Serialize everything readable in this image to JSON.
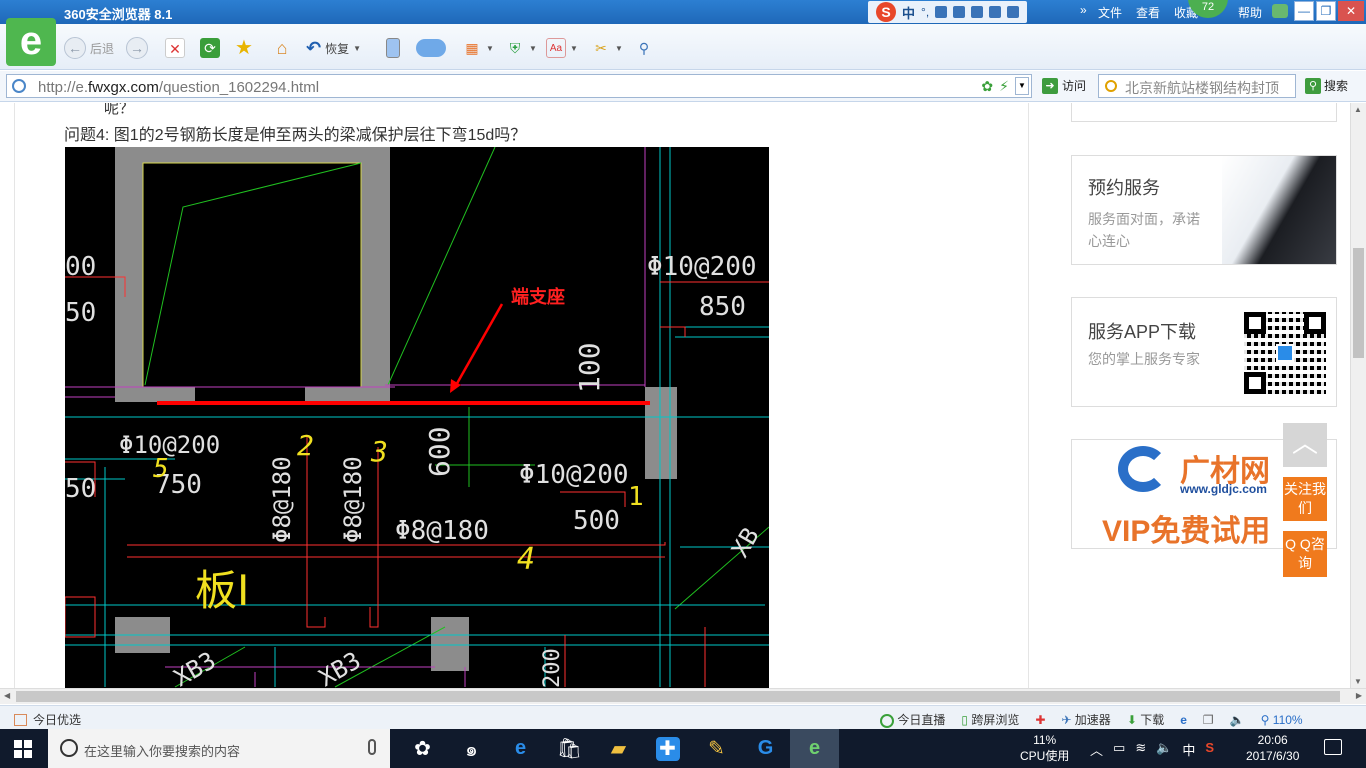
{
  "browser": {
    "title": "360安全浏览器 8.1",
    "menus": [
      "文件",
      "查看",
      "收藏",
      "帮助"
    ],
    "badge": "72",
    "sogou_label": "中",
    "toolbar": {
      "back_label": "后退",
      "restore_label": "恢复"
    },
    "address": {
      "prefix": "http://e.",
      "domain": "fwxgx.com",
      "path": "/question_1602294.html"
    },
    "visit_label": "访问",
    "search_value": "北京新航站楼钢结构封顶",
    "search_button": "搜索"
  },
  "page": {
    "prev_text": "呢？",
    "question": "问题4:  图1的2号钢筋长度是伸至两头的梁减保护层往下弯15d吗？",
    "drawing": {
      "annotation": "端支座",
      "labels": {
        "r1": "Φ10@200",
        "r2": "850",
        "r3": "Φ10@200",
        "r4": "750",
        "r5": "Φ8@180",
        "r6": "Φ8@180",
        "r7": "Φ8@180",
        "r8": "Φ10@200",
        "r9": "500",
        "r10": "600",
        "r11": "100",
        "r12": "00",
        "r13": "50",
        "r14": "50",
        "r15": "XB3",
        "r16": "XB3",
        "r17": "XB",
        "r18": "200",
        "n2": "2",
        "n3": "3",
        "n4": "4",
        "n5": "5",
        "n1": "1",
        "ban": "板I"
      }
    },
    "sidebar": {
      "card1": {
        "title": "预约服务",
        "subtitle": "服务面对面，承诺心连心"
      },
      "card2": {
        "title": "服务APP下载",
        "subtitle": "您的掌上服务专家"
      },
      "card3": {
        "brand": "广材网",
        "url": "www.gldjc.com",
        "promo": "VIP免费试用"
      }
    },
    "float": {
      "follow": "关注我们",
      "qq": "Q Q咨询"
    }
  },
  "statusbar": {
    "today": "今日优选",
    "items": [
      "今日直播",
      "跨屏浏览",
      "加速器",
      "下载"
    ],
    "zoom": "110%"
  },
  "taskbar": {
    "search_placeholder": "在这里输入你要搜索的内容",
    "cpu_value": "11%",
    "cpu_label": "CPU使用",
    "ime": "中",
    "time": "20:06",
    "date": "2017/6/30"
  },
  "colors": {
    "titlebar": "#1f68b8",
    "cad_background": "#000000",
    "rebar_red": "#ff0000",
    "logo_green": "#4fb74f",
    "float_orange": "#f07a1d"
  }
}
